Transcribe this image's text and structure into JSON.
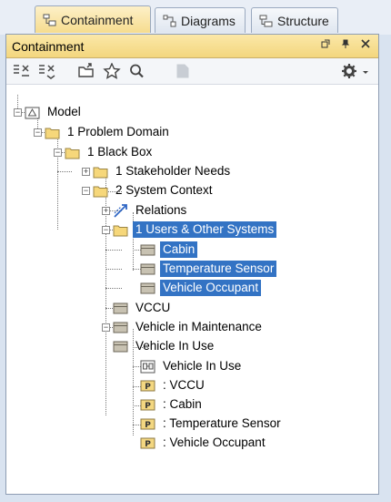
{
  "tabs": [
    {
      "label": "Containment",
      "icon": "containment-tab-icon",
      "active": true
    },
    {
      "label": "Diagrams",
      "icon": "diagrams-tab-icon",
      "active": false
    },
    {
      "label": "Structure",
      "icon": "structure-tab-icon",
      "active": false
    }
  ],
  "panel": {
    "title": "Containment"
  },
  "tree": [
    {
      "label": "Model",
      "icon": "model-package-icon",
      "selected": false
    },
    {
      "label": "1 Problem Domain",
      "icon": "folder-icon",
      "selected": false
    },
    {
      "label": "1 Black Box",
      "icon": "folder-icon",
      "selected": false
    },
    {
      "label": "1 Stakeholder Needs",
      "icon": "folder-icon",
      "selected": false
    },
    {
      "label": "2 System Context",
      "icon": "folder-icon",
      "selected": false
    },
    {
      "label": "Relations",
      "icon": "relations-icon",
      "selected": false
    },
    {
      "label": "1 Users & Other Systems",
      "icon": "folder-icon",
      "selected": true
    },
    {
      "label": "Cabin",
      "icon": "block-icon",
      "selected": true
    },
    {
      "label": "Temperature Sensor",
      "icon": "block-icon",
      "selected": true
    },
    {
      "label": "Vehicle Occupant",
      "icon": "block-icon",
      "selected": true
    },
    {
      "label": "VCCU",
      "icon": "block-icon",
      "selected": false
    },
    {
      "label": "Vehicle in Maintenance",
      "icon": "block-icon",
      "selected": false
    },
    {
      "label": "Vehicle In Use",
      "icon": "block-icon",
      "selected": false
    },
    {
      "label": "Vehicle In Use",
      "icon": "ibd-diagram-icon",
      "selected": false
    },
    {
      "label": ": VCCU",
      "icon": "part-icon",
      "selected": false
    },
    {
      "label": ": Cabin",
      "icon": "part-icon",
      "selected": false
    },
    {
      "label": ": Temperature Sensor",
      "icon": "part-icon",
      "selected": false
    },
    {
      "label": ": Vehicle Occupant",
      "icon": "part-icon",
      "selected": false
    }
  ],
  "colors": {
    "selection": "#3373c4",
    "titlebar": "#f3d67e",
    "folder": "#f6d77a"
  }
}
